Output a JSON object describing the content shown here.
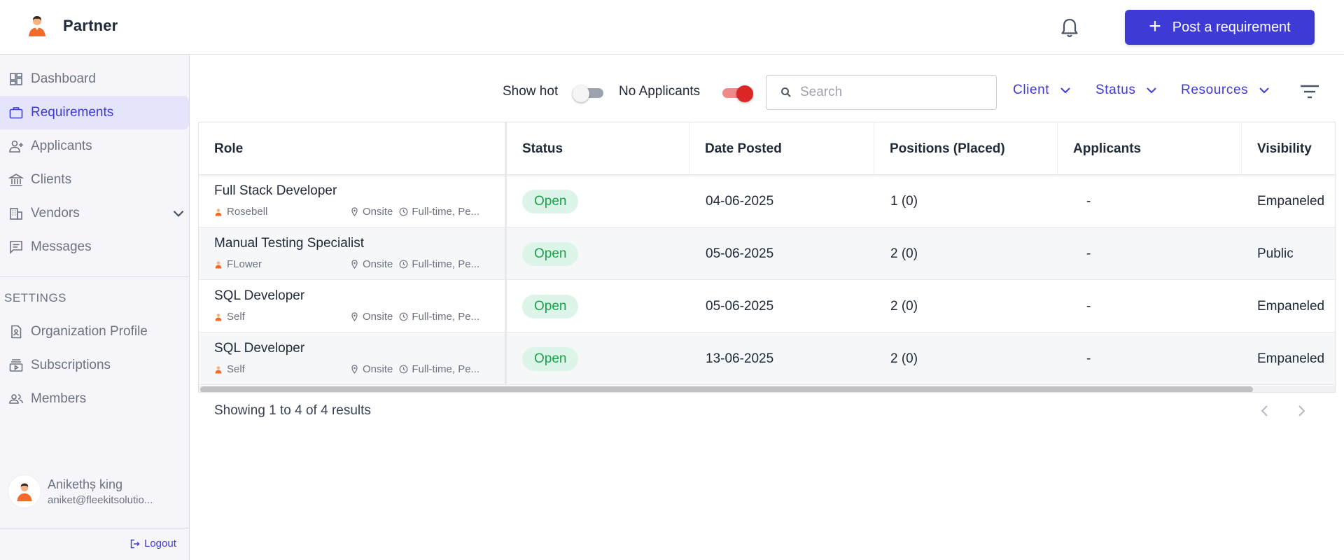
{
  "app": {
    "brand": "Partner"
  },
  "header": {
    "post_label": "Post a requirement"
  },
  "sidebar": {
    "items": [
      {
        "label": "Dashboard",
        "icon": "dashboard-icon"
      },
      {
        "label": "Requirements",
        "icon": "briefcase-icon",
        "active": true
      },
      {
        "label": "Applicants",
        "icon": "user-plus-icon"
      },
      {
        "label": "Clients",
        "icon": "bank-icon"
      },
      {
        "label": "Vendors",
        "icon": "building-icon"
      },
      {
        "label": "Messages",
        "icon": "message-icon"
      }
    ],
    "settings_label": "SETTINGS",
    "settings_items": [
      {
        "label": "Organization Profile",
        "icon": "document-icon"
      },
      {
        "label": "Subscriptions",
        "icon": "subscriptions-icon"
      },
      {
        "label": "Members",
        "icon": "members-icon"
      }
    ],
    "user": {
      "name": "Anikethș king",
      "email": "aniket@fleekitsolutio..."
    },
    "logout_label": "Logout"
  },
  "filters": {
    "show_hot_label": "Show hot",
    "show_hot_on": false,
    "no_applicants_label": "No Applicants",
    "no_applicants_on": true,
    "search_placeholder": "Search",
    "client_label": "Client",
    "status_label": "Status",
    "resources_label": "Resources"
  },
  "table": {
    "headers": [
      "Role",
      "Status",
      "Date Posted",
      "Positions (Placed)",
      "Applicants",
      "Visibility"
    ],
    "rows": [
      {
        "role": "Full Stack Developer",
        "client": "Rosebell",
        "location": "Onsite",
        "type": "Full-time, Pe...",
        "status": "Open",
        "date": "04-06-2025",
        "positions": "1 (0)",
        "applicants": "-",
        "visibility": "Empaneled"
      },
      {
        "role": "Manual Testing Specialist",
        "client": "FLower",
        "location": "Onsite",
        "type": "Full-time, Pe...",
        "status": "Open",
        "date": "05-06-2025",
        "positions": "2 (0)",
        "applicants": "-",
        "visibility": "Public"
      },
      {
        "role": "SQL Developer",
        "client": "Self",
        "location": "Onsite",
        "type": "Full-time, Pe...",
        "status": "Open",
        "date": "05-06-2025",
        "positions": "2 (0)",
        "applicants": "-",
        "visibility": "Empaneled"
      },
      {
        "role": "SQL Developer",
        "client": "Self",
        "location": "Onsite",
        "type": "Full-time, Pe...",
        "status": "Open",
        "date": "13-06-2025",
        "positions": "2 (0)",
        "applicants": "-",
        "visibility": "Empaneled"
      }
    ]
  },
  "pagination": {
    "summary": "Showing 1 to 4 of 4 results"
  },
  "colors": {
    "accent": "#3e3ad6",
    "toggle_on": "#dc2626",
    "open_badge_bg": "#dcf5e8",
    "open_badge_text": "#16a34a"
  }
}
